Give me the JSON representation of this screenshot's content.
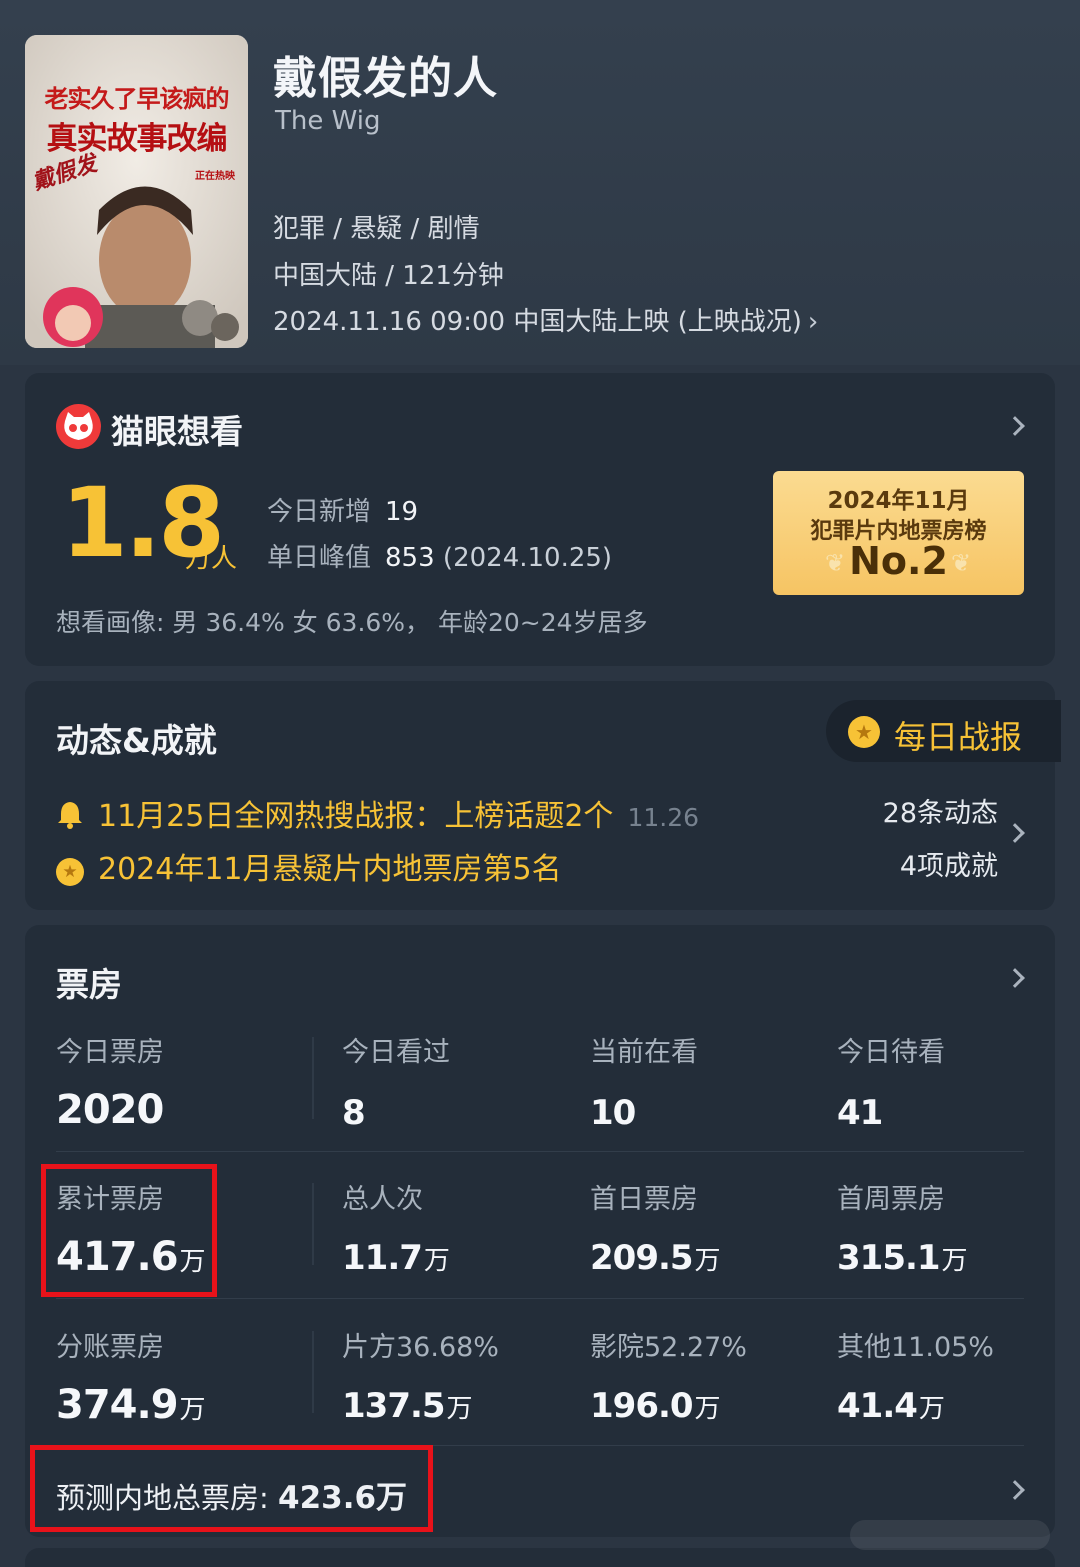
{
  "movie": {
    "poster_text_line1": "老实久了早该疯的",
    "poster_text_line2": "真实故事改编",
    "poster_badge": "正在热映",
    "poster_logo": "戴假发",
    "title": "戴假发的人",
    "subtitle": "The Wig",
    "genres": "犯罪 / 悬疑 / 剧情",
    "region_runtime": "中国大陆 / 121分钟",
    "release": "2024.11.16 09:00 中国大陆上映 (上映战况)"
  },
  "want": {
    "title": "猫眼想看",
    "count": "1.8",
    "unit": "万人",
    "today_new_label": "今日新增",
    "today_new_value": "19",
    "peak_label": "单日峰值",
    "peak_value": "853",
    "peak_date": "(2024.10.25)",
    "portrait": "想看画像: 男 36.4%   女 63.6%， 年龄20~24岁居多",
    "rank_line1": "2024年11月",
    "rank_line2": "犯罪片内地票房榜",
    "rank_value": "No.2"
  },
  "news": {
    "title": "动态&成就",
    "daily_report": "每日战报",
    "item1": "11月25日全网热搜战报：上榜话题2个",
    "item1_date": "11.26",
    "item2": "2024年11月悬疑片内地票房第5名",
    "count1": "28条动态",
    "count2": "4项成就"
  },
  "box": {
    "title": "票房",
    "rows": [
      [
        {
          "label": "今日票房",
          "value": "2020",
          "unit": ""
        },
        {
          "label": "今日看过",
          "value": "8",
          "unit": ""
        },
        {
          "label": "当前在看",
          "value": "10",
          "unit": ""
        },
        {
          "label": "今日待看",
          "value": "41",
          "unit": ""
        }
      ],
      [
        {
          "label": "累计票房",
          "value": "417.6",
          "unit": "万"
        },
        {
          "label": "总人次",
          "value": "11.7",
          "unit": "万"
        },
        {
          "label": "首日票房",
          "value": "209.5",
          "unit": "万"
        },
        {
          "label": "首周票房",
          "value": "315.1",
          "unit": "万"
        }
      ],
      [
        {
          "label": "分账票房",
          "value": "374.9",
          "unit": "万"
        },
        {
          "label": "片方36.68%",
          "value": "137.5",
          "unit": "万"
        },
        {
          "label": "影院52.27%",
          "value": "196.0",
          "unit": "万"
        },
        {
          "label": "其他11.05%",
          "value": "41.4",
          "unit": "万"
        }
      ]
    ],
    "forecast_label": "预测内地总票房:",
    "forecast_value": "423.6万"
  },
  "colors": {
    "accent": "#f7c236",
    "highlight": "#e8121a",
    "card": "#232d39",
    "background": "#2b3542"
  }
}
